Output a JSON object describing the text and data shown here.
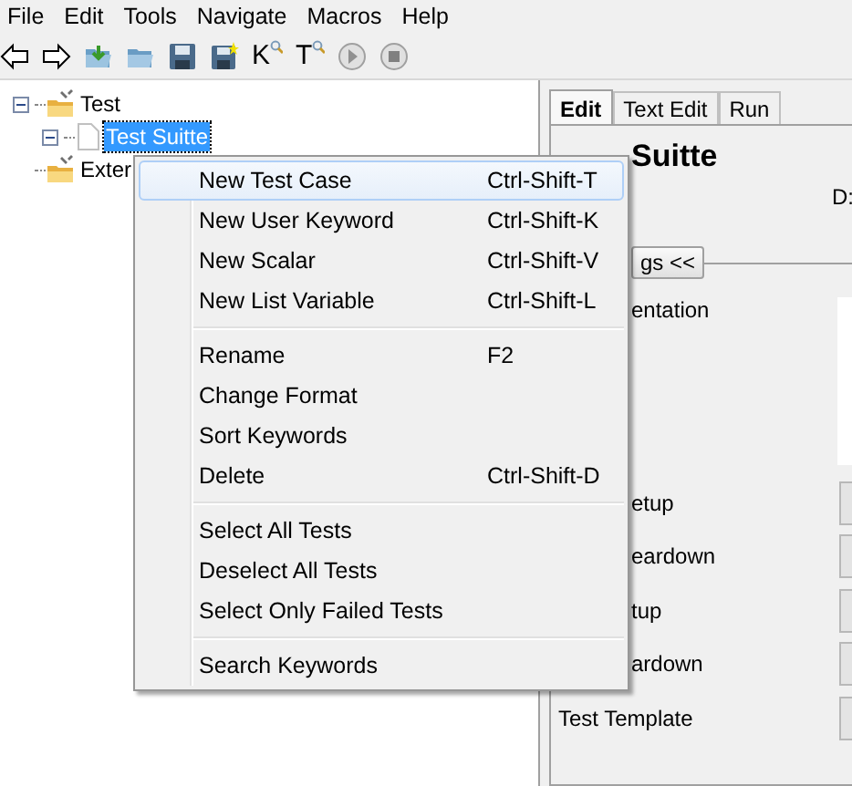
{
  "menubar": [
    "File",
    "Edit",
    "Tools",
    "Navigate",
    "Macros",
    "Help"
  ],
  "toolbar": [
    {
      "kind": "back"
    },
    {
      "kind": "forward"
    },
    {
      "kind": "open-dir"
    },
    {
      "kind": "folder"
    },
    {
      "kind": "save"
    },
    {
      "kind": "save-all"
    },
    {
      "kind": "text",
      "label": "K"
    },
    {
      "kind": "text",
      "label": "T"
    },
    {
      "kind": "run"
    },
    {
      "kind": "stop"
    }
  ],
  "tree": [
    {
      "label": "Test",
      "kind": "folder",
      "expanded": true,
      "selected": false,
      "children": [
        {
          "label": "Test Suitte",
          "kind": "file",
          "expanded": true,
          "selected": true
        }
      ]
    },
    {
      "label": "Exter",
      "kind": "folder",
      "selected": false
    }
  ],
  "editor": {
    "tabs": [
      {
        "label": "Edit",
        "selected": true
      },
      {
        "label": "Text Edit",
        "selected": false
      },
      {
        "label": "Run",
        "selected": false
      }
    ],
    "title": "Suitte",
    "source": "D:",
    "settings_button": "gs <<",
    "documentation_label": "entation",
    "settings": [
      {
        "label": "etup",
        "kind": "clipped"
      },
      {
        "label": "eardown",
        "kind": "clipped"
      },
      {
        "label": "tup",
        "kind": "clipped"
      },
      {
        "label": "ardown",
        "kind": "clipped"
      },
      {
        "label": "Test Template",
        "kind": "full"
      }
    ]
  },
  "context_menu": {
    "groups": [
      [
        {
          "label": "New Test Case",
          "shortcut": "Ctrl-Shift-T",
          "selected": true
        },
        {
          "label": "New User Keyword",
          "shortcut": "Ctrl-Shift-K",
          "selected": false
        },
        {
          "label": "New Scalar",
          "shortcut": "Ctrl-Shift-V",
          "selected": false
        },
        {
          "label": "New List Variable",
          "shortcut": "Ctrl-Shift-L",
          "selected": false
        }
      ],
      [
        {
          "label": "Rename",
          "shortcut": "F2",
          "selected": false
        },
        {
          "label": "Change Format",
          "selected": false
        },
        {
          "label": "Sort Keywords",
          "selected": false
        },
        {
          "label": "Delete",
          "shortcut": "Ctrl-Shift-D",
          "selected": false
        }
      ],
      [
        {
          "label": "Select All Tests",
          "selected": false
        },
        {
          "label": "Deselect All Tests",
          "selected": false
        },
        {
          "label": "Select Only Failed Tests",
          "selected": false
        }
      ],
      [
        {
          "label": "Search Keywords",
          "selected": false
        }
      ]
    ]
  }
}
